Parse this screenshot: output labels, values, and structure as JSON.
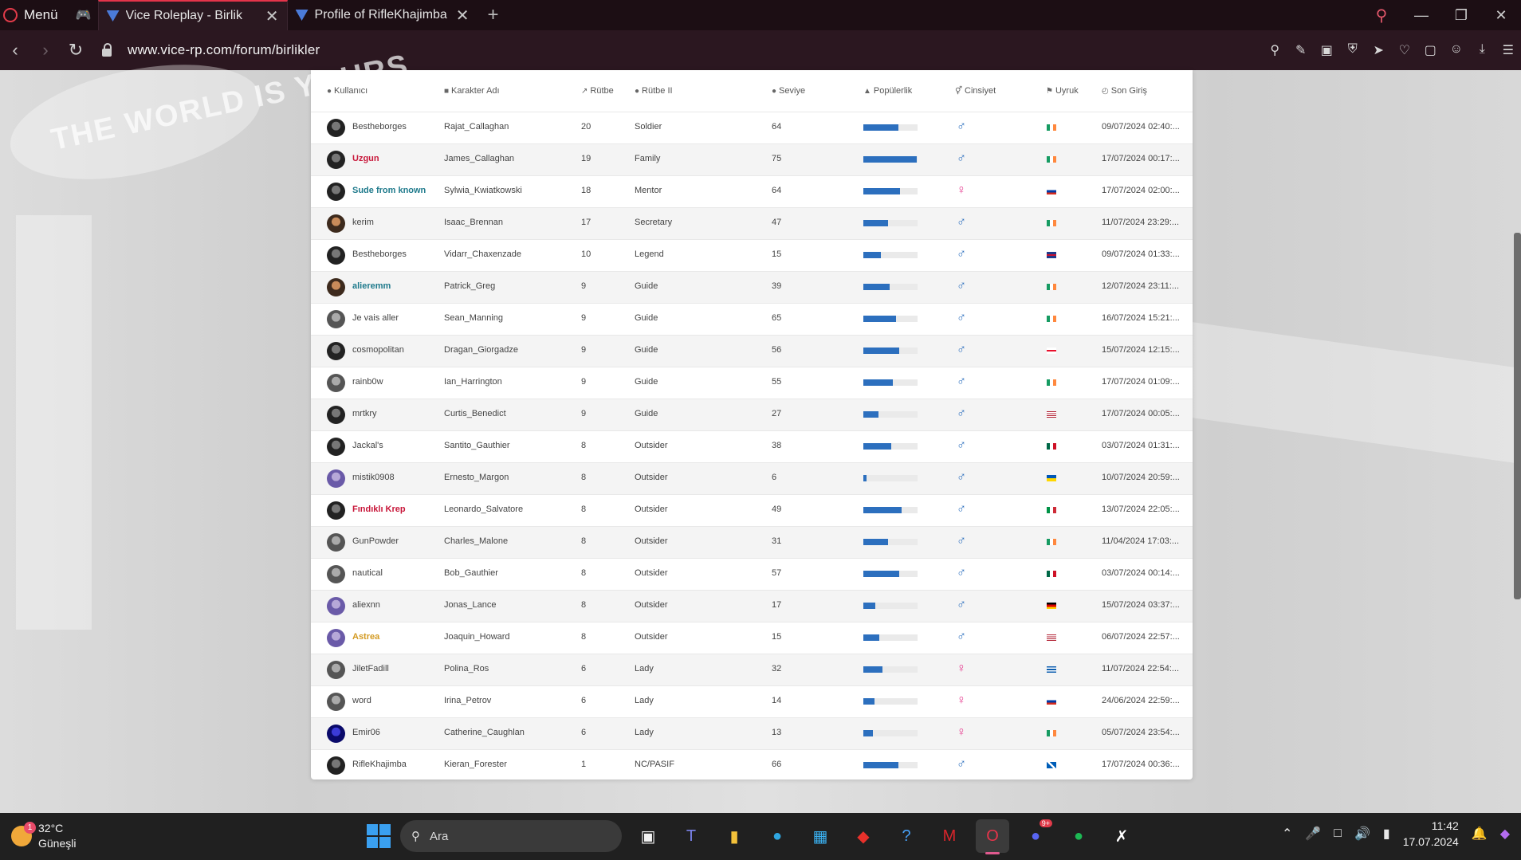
{
  "browser": {
    "menu_label": "Menü",
    "tabs": [
      {
        "title": "Vice Roleplay - Birlik",
        "active": true
      },
      {
        "title": "Profile of RifleKhajimba",
        "active": false
      }
    ],
    "url": "www.vice-rp.com/forum/birlikler"
  },
  "background": {
    "blimp_text": "THE WORLD IS YOURS"
  },
  "table": {
    "columns": [
      "Kullanıcı",
      "Karakter Adı",
      "Rütbe",
      "Rütbe II",
      "Seviye",
      "Popülerlik",
      "Cinsiyet",
      "Uyruk",
      "Son Giriş"
    ],
    "rows": [
      {
        "user": "Bestheborges",
        "char": "Rajat_Callaghan",
        "rank": "20",
        "rank2": "Soldier",
        "level": "64",
        "pop": 0.64,
        "gender": "male",
        "flag": "Ireland",
        "last": "09/07/2024 02:40:..."
      },
      {
        "user": "Uzgun",
        "char": "James_Callaghan",
        "rank": "19",
        "rank2": "Family",
        "level": "75",
        "pop": 0.98,
        "gender": "male",
        "flag": "Ireland",
        "last": "17/07/2024 00:17:..."
      },
      {
        "user": "Sude from known",
        "char": "Sylwia_Kwiatkowski",
        "rank": "18",
        "rank2": "Mentor",
        "level": "64",
        "pop": 0.68,
        "gender": "female",
        "flag": "Russia",
        "last": "17/07/2024 02:00:..."
      },
      {
        "user": "kerim",
        "char": "Isaac_Brennan",
        "rank": "17",
        "rank2": "Secretary",
        "level": "47",
        "pop": 0.46,
        "gender": "male",
        "flag": "Ireland",
        "last": "11/07/2024 23:29:..."
      },
      {
        "user": "Bestheborges",
        "char": "Vidarr_Chaxenzade",
        "rank": "10",
        "rank2": "Legend",
        "level": "15",
        "pop": 0.32,
        "gender": "male",
        "flag": "United Kingdom",
        "last": "09/07/2024 01:33:..."
      },
      {
        "user": "alieremm",
        "char": "Patrick_Greg",
        "rank": "9",
        "rank2": "Guide",
        "level": "39",
        "pop": 0.48,
        "gender": "male",
        "flag": "Ireland",
        "last": "12/07/2024 23:11:..."
      },
      {
        "user": "Je vais aller",
        "char": "Sean_Manning",
        "rank": "9",
        "rank2": "Guide",
        "level": "65",
        "pop": 0.6,
        "gender": "male",
        "flag": "Ireland",
        "last": "16/07/2024 15:21:..."
      },
      {
        "user": "cosmopolitan",
        "char": "Dragan_Giorgadze",
        "rank": "9",
        "rank2": "Guide",
        "level": "56",
        "pop": 0.66,
        "gender": "male",
        "flag": "Georgia",
        "last": "15/07/2024 12:15:..."
      },
      {
        "user": "rainb0w",
        "char": "Ian_Harrington",
        "rank": "9",
        "rank2": "Guide",
        "level": "55",
        "pop": 0.54,
        "gender": "male",
        "flag": "Ireland",
        "last": "17/07/2024 01:09:..."
      },
      {
        "user": "mrtkry",
        "char": "Curtis_Benedict",
        "rank": "9",
        "rank2": "Guide",
        "level": "27",
        "pop": 0.28,
        "gender": "male",
        "flag": "United States",
        "last": "17/07/2024 00:05:..."
      },
      {
        "user": "Jackal's",
        "char": "Santito_Gauthier",
        "rank": "8",
        "rank2": "Outsider",
        "level": "38",
        "pop": 0.52,
        "gender": "male",
        "flag": "Mexico",
        "last": "03/07/2024 01:31:..."
      },
      {
        "user": "mistik0908",
        "char": "Ernesto_Margon",
        "rank": "8",
        "rank2": "Outsider",
        "level": "6",
        "pop": 0.06,
        "gender": "male",
        "flag": "Ukraine",
        "last": "10/07/2024 20:59:..."
      },
      {
        "user": "Fındıklı Krep",
        "char": "Leonardo_Salvatore",
        "rank": "8",
        "rank2": "Outsider",
        "level": "49",
        "pop": 0.7,
        "gender": "male",
        "flag": "Italy",
        "last": "13/07/2024 22:05:..."
      },
      {
        "user": "GunPowder",
        "char": "Charles_Malone",
        "rank": "8",
        "rank2": "Outsider",
        "level": "31",
        "pop": 0.46,
        "gender": "male",
        "flag": "Ireland",
        "last": "11/04/2024 17:03:..."
      },
      {
        "user": "nautical",
        "char": "Bob_Gauthier",
        "rank": "8",
        "rank2": "Outsider",
        "level": "57",
        "pop": 0.66,
        "gender": "male",
        "flag": "Mexico",
        "last": "03/07/2024 00:14:..."
      },
      {
        "user": "aliexnn",
        "char": "Jonas_Lance",
        "rank": "8",
        "rank2": "Outsider",
        "level": "17",
        "pop": 0.22,
        "gender": "male",
        "flag": "Germany",
        "last": "15/07/2024 03:37:..."
      },
      {
        "user": "Astrea",
        "char": "Joaquin_Howard",
        "rank": "8",
        "rank2": "Outsider",
        "level": "15",
        "pop": 0.3,
        "gender": "male",
        "flag": "United States",
        "last": "06/07/2024 22:57:..."
      },
      {
        "user": "JiletFadill",
        "char": "Polina_Ros",
        "rank": "6",
        "rank2": "Lady",
        "level": "32",
        "pop": 0.36,
        "gender": "female",
        "flag": "Greece",
        "last": "11/07/2024 22:54:..."
      },
      {
        "user": "word",
        "char": "Irina_Petrov",
        "rank": "6",
        "rank2": "Lady",
        "level": "14",
        "pop": 0.2,
        "gender": "female",
        "flag": "Russia",
        "last": "24/06/2024 22:59:..."
      },
      {
        "user": "Emir06",
        "char": "Catherine_Caughlan",
        "rank": "6",
        "rank2": "Lady",
        "level": "13",
        "pop": 0.18,
        "gender": "female",
        "flag": "Ireland",
        "last": "05/07/2024 23:54:..."
      },
      {
        "user": "RifleKhajimba",
        "char": "Kieran_Forester",
        "rank": "1",
        "rank2": "NC/PASIF",
        "level": "66",
        "pop": 0.64,
        "gender": "male",
        "flag": "Scotland",
        "last": "17/07/2024 00:36:..."
      }
    ]
  },
  "taskbar": {
    "weather_temp": "32°C",
    "weather_desc": "Güneşli",
    "weather_badge": "1",
    "search_placeholder": "Ara",
    "discord_badge": "9+",
    "time": "11:42",
    "date": "17.07.2024"
  },
  "colors": {
    "accent": "#e5344a",
    "bar": "#2c6fbe",
    "male": "#2c6fbe",
    "female": "#e63b8f"
  }
}
